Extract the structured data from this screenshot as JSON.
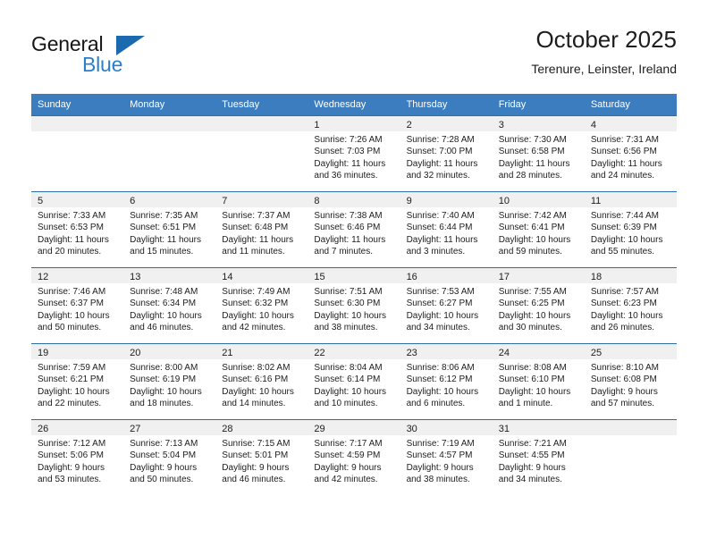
{
  "brand": {
    "name_part1": "General",
    "name_part2": "Blue",
    "logo_icon": "triangle-logo-icon",
    "accent_color": "#1b69ae",
    "text_color": "#2a7fc9"
  },
  "header": {
    "title": "October 2025",
    "subtitle": "Terenure, Leinster, Ireland"
  },
  "calendar": {
    "header_bg": "#3b7dbf",
    "header_text_color": "#ffffff",
    "row_divider_color": "#2c6ca8",
    "daynum_band_color": "#f0f0f0",
    "weekday_headers": [
      "Sunday",
      "Monday",
      "Tuesday",
      "Wednesday",
      "Thursday",
      "Friday",
      "Saturday"
    ],
    "weeks": [
      [
        {
          "day": "",
          "sunrise": "",
          "sunset": "",
          "daylight": "",
          "empty": true
        },
        {
          "day": "",
          "sunrise": "",
          "sunset": "",
          "daylight": "",
          "empty": true
        },
        {
          "day": "",
          "sunrise": "",
          "sunset": "",
          "daylight": "",
          "empty": true
        },
        {
          "day": "1",
          "sunrise": "Sunrise: 7:26 AM",
          "sunset": "Sunset: 7:03 PM",
          "daylight": "Daylight: 11 hours and 36 minutes.",
          "empty": false
        },
        {
          "day": "2",
          "sunrise": "Sunrise: 7:28 AM",
          "sunset": "Sunset: 7:00 PM",
          "daylight": "Daylight: 11 hours and 32 minutes.",
          "empty": false
        },
        {
          "day": "3",
          "sunrise": "Sunrise: 7:30 AM",
          "sunset": "Sunset: 6:58 PM",
          "daylight": "Daylight: 11 hours and 28 minutes.",
          "empty": false
        },
        {
          "day": "4",
          "sunrise": "Sunrise: 7:31 AM",
          "sunset": "Sunset: 6:56 PM",
          "daylight": "Daylight: 11 hours and 24 minutes.",
          "empty": false
        }
      ],
      [
        {
          "day": "5",
          "sunrise": "Sunrise: 7:33 AM",
          "sunset": "Sunset: 6:53 PM",
          "daylight": "Daylight: 11 hours and 20 minutes.",
          "empty": false
        },
        {
          "day": "6",
          "sunrise": "Sunrise: 7:35 AM",
          "sunset": "Sunset: 6:51 PM",
          "daylight": "Daylight: 11 hours and 15 minutes.",
          "empty": false
        },
        {
          "day": "7",
          "sunrise": "Sunrise: 7:37 AM",
          "sunset": "Sunset: 6:48 PM",
          "daylight": "Daylight: 11 hours and 11 minutes.",
          "empty": false
        },
        {
          "day": "8",
          "sunrise": "Sunrise: 7:38 AM",
          "sunset": "Sunset: 6:46 PM",
          "daylight": "Daylight: 11 hours and 7 minutes.",
          "empty": false
        },
        {
          "day": "9",
          "sunrise": "Sunrise: 7:40 AM",
          "sunset": "Sunset: 6:44 PM",
          "daylight": "Daylight: 11 hours and 3 minutes.",
          "empty": false
        },
        {
          "day": "10",
          "sunrise": "Sunrise: 7:42 AM",
          "sunset": "Sunset: 6:41 PM",
          "daylight": "Daylight: 10 hours and 59 minutes.",
          "empty": false
        },
        {
          "day": "11",
          "sunrise": "Sunrise: 7:44 AM",
          "sunset": "Sunset: 6:39 PM",
          "daylight": "Daylight: 10 hours and 55 minutes.",
          "empty": false
        }
      ],
      [
        {
          "day": "12",
          "sunrise": "Sunrise: 7:46 AM",
          "sunset": "Sunset: 6:37 PM",
          "daylight": "Daylight: 10 hours and 50 minutes.",
          "empty": false
        },
        {
          "day": "13",
          "sunrise": "Sunrise: 7:48 AM",
          "sunset": "Sunset: 6:34 PM",
          "daylight": "Daylight: 10 hours and 46 minutes.",
          "empty": false
        },
        {
          "day": "14",
          "sunrise": "Sunrise: 7:49 AM",
          "sunset": "Sunset: 6:32 PM",
          "daylight": "Daylight: 10 hours and 42 minutes.",
          "empty": false
        },
        {
          "day": "15",
          "sunrise": "Sunrise: 7:51 AM",
          "sunset": "Sunset: 6:30 PM",
          "daylight": "Daylight: 10 hours and 38 minutes.",
          "empty": false
        },
        {
          "day": "16",
          "sunrise": "Sunrise: 7:53 AM",
          "sunset": "Sunset: 6:27 PM",
          "daylight": "Daylight: 10 hours and 34 minutes.",
          "empty": false
        },
        {
          "day": "17",
          "sunrise": "Sunrise: 7:55 AM",
          "sunset": "Sunset: 6:25 PM",
          "daylight": "Daylight: 10 hours and 30 minutes.",
          "empty": false
        },
        {
          "day": "18",
          "sunrise": "Sunrise: 7:57 AM",
          "sunset": "Sunset: 6:23 PM",
          "daylight": "Daylight: 10 hours and 26 minutes.",
          "empty": false
        }
      ],
      [
        {
          "day": "19",
          "sunrise": "Sunrise: 7:59 AM",
          "sunset": "Sunset: 6:21 PM",
          "daylight": "Daylight: 10 hours and 22 minutes.",
          "empty": false
        },
        {
          "day": "20",
          "sunrise": "Sunrise: 8:00 AM",
          "sunset": "Sunset: 6:19 PM",
          "daylight": "Daylight: 10 hours and 18 minutes.",
          "empty": false
        },
        {
          "day": "21",
          "sunrise": "Sunrise: 8:02 AM",
          "sunset": "Sunset: 6:16 PM",
          "daylight": "Daylight: 10 hours and 14 minutes.",
          "empty": false
        },
        {
          "day": "22",
          "sunrise": "Sunrise: 8:04 AM",
          "sunset": "Sunset: 6:14 PM",
          "daylight": "Daylight: 10 hours and 10 minutes.",
          "empty": false
        },
        {
          "day": "23",
          "sunrise": "Sunrise: 8:06 AM",
          "sunset": "Sunset: 6:12 PM",
          "daylight": "Daylight: 10 hours and 6 minutes.",
          "empty": false
        },
        {
          "day": "24",
          "sunrise": "Sunrise: 8:08 AM",
          "sunset": "Sunset: 6:10 PM",
          "daylight": "Daylight: 10 hours and 1 minute.",
          "empty": false
        },
        {
          "day": "25",
          "sunrise": "Sunrise: 8:10 AM",
          "sunset": "Sunset: 6:08 PM",
          "daylight": "Daylight: 9 hours and 57 minutes.",
          "empty": false
        }
      ],
      [
        {
          "day": "26",
          "sunrise": "Sunrise: 7:12 AM",
          "sunset": "Sunset: 5:06 PM",
          "daylight": "Daylight: 9 hours and 53 minutes.",
          "empty": false
        },
        {
          "day": "27",
          "sunrise": "Sunrise: 7:13 AM",
          "sunset": "Sunset: 5:04 PM",
          "daylight": "Daylight: 9 hours and 50 minutes.",
          "empty": false
        },
        {
          "day": "28",
          "sunrise": "Sunrise: 7:15 AM",
          "sunset": "Sunset: 5:01 PM",
          "daylight": "Daylight: 9 hours and 46 minutes.",
          "empty": false
        },
        {
          "day": "29",
          "sunrise": "Sunrise: 7:17 AM",
          "sunset": "Sunset: 4:59 PM",
          "daylight": "Daylight: 9 hours and 42 minutes.",
          "empty": false
        },
        {
          "day": "30",
          "sunrise": "Sunrise: 7:19 AM",
          "sunset": "Sunset: 4:57 PM",
          "daylight": "Daylight: 9 hours and 38 minutes.",
          "empty": false
        },
        {
          "day": "31",
          "sunrise": "Sunrise: 7:21 AM",
          "sunset": "Sunset: 4:55 PM",
          "daylight": "Daylight: 9 hours and 34 minutes.",
          "empty": false
        },
        {
          "day": "",
          "sunrise": "",
          "sunset": "",
          "daylight": "",
          "empty": true
        }
      ]
    ]
  }
}
